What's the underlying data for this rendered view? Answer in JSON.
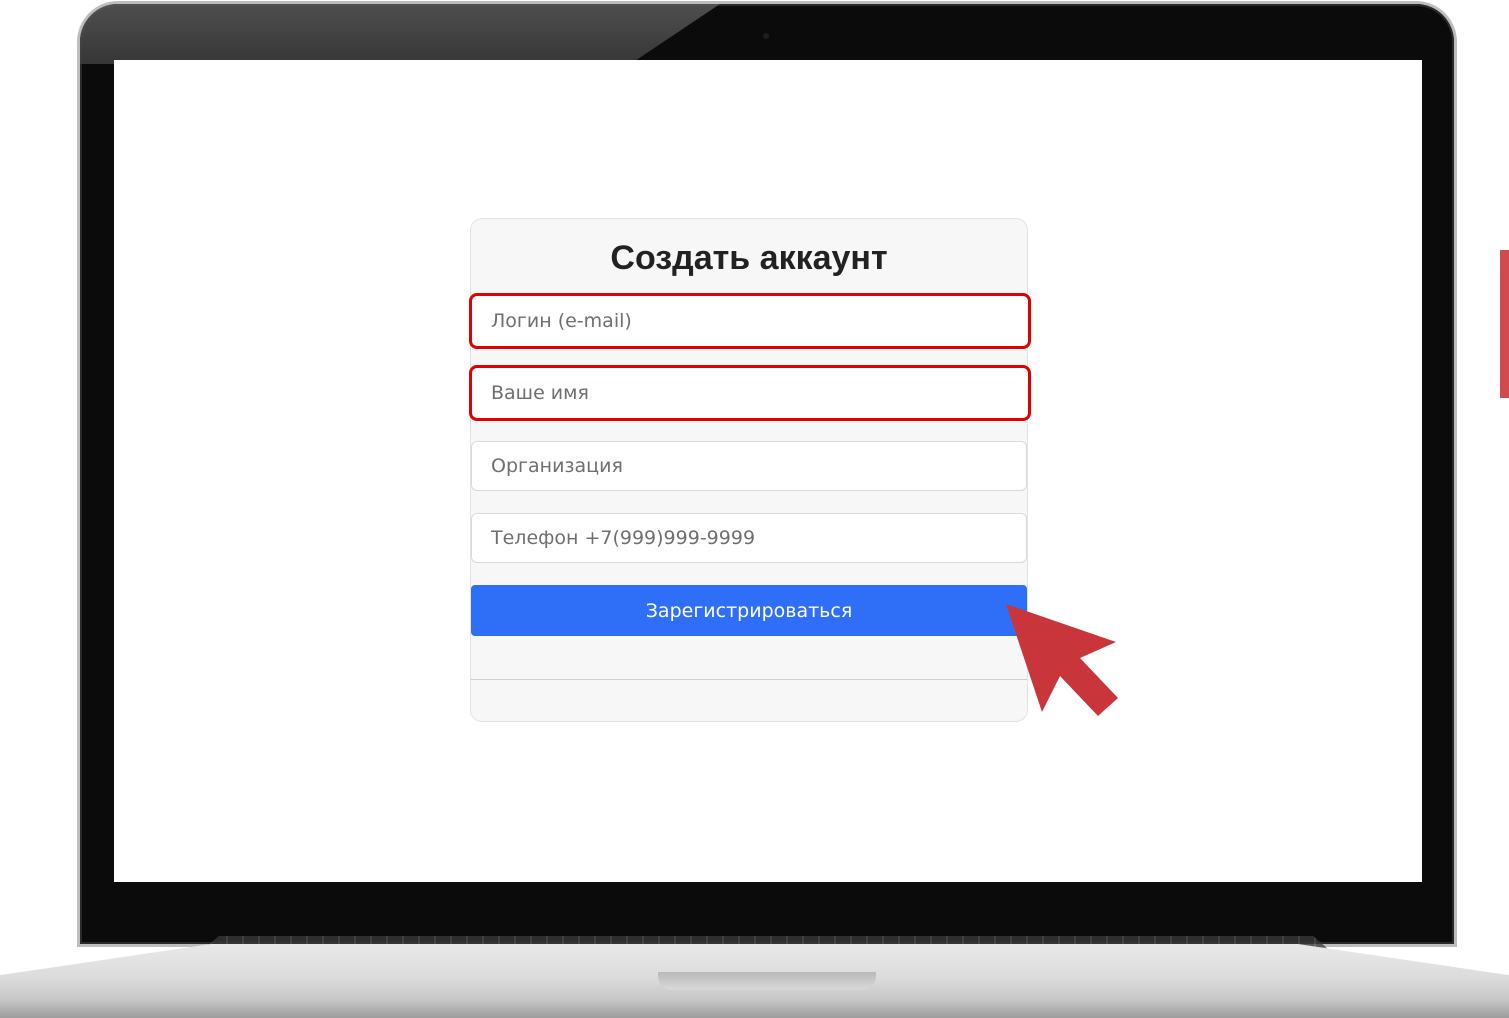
{
  "form": {
    "title": "Создать аккаунт",
    "fields": [
      {
        "placeholder": "Логин (e-mail)",
        "highlighted": true
      },
      {
        "placeholder": "Ваше имя",
        "highlighted": true
      },
      {
        "placeholder": "Организация",
        "highlighted": false
      },
      {
        "placeholder": "Телефон +7(999)999-9999",
        "highlighted": false
      }
    ],
    "submit_label": "Зарегистрироваться"
  },
  "colors": {
    "button": "#2f6ff7",
    "highlight": "#e00000",
    "pointer": "#c8353b"
  },
  "icons": {
    "pointer": "arrow-cursor-icon"
  }
}
